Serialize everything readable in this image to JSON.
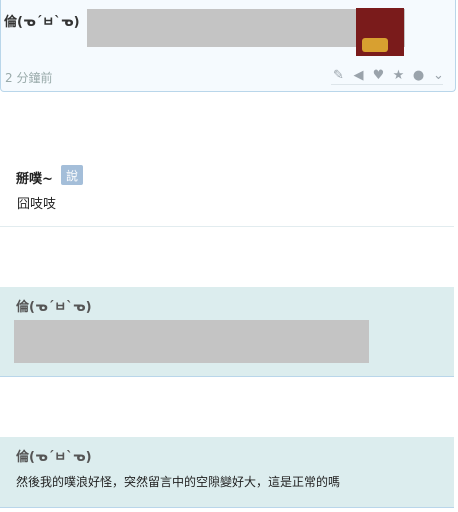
{
  "top_plurk": {
    "author": "倫(ᓀ´ㅂ`ᓀ)",
    "time": "2 分鐘前",
    "actions": [
      {
        "name": "edit-icon",
        "glyph": "✎"
      },
      {
        "name": "mute-icon",
        "glyph": "🔈"
      },
      {
        "name": "like-icon",
        "glyph": "♥"
      },
      {
        "name": "favorite-icon",
        "glyph": "★"
      },
      {
        "name": "replurk-icon",
        "glyph": "⟳"
      },
      {
        "name": "more-icon",
        "glyph": "⌄"
      }
    ]
  },
  "response": {
    "name": "掰噗~",
    "qualifier": "說",
    "text": "囧吱吱"
  },
  "card2": {
    "author": "倫(ᓀ´ㅂ`ᓀ)"
  },
  "card3": {
    "author": "倫(ᓀ´ㅂ`ᓀ)",
    "message": "然後我的噗浪好怪，突然留言中的空隙變好大，這是正常的嗎"
  },
  "colors": {
    "card_bg": "#dcedee",
    "badge_bg": "#a4bed9",
    "top_bg": "#f5fafe"
  }
}
